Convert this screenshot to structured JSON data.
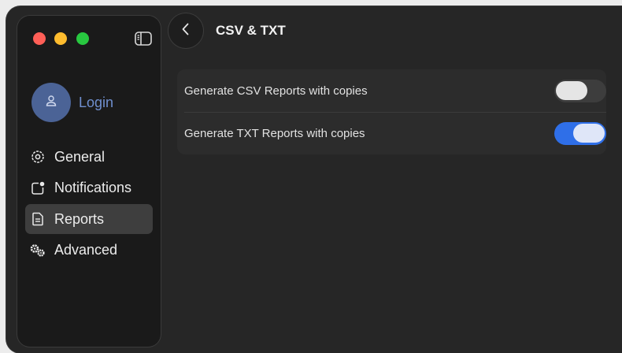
{
  "window": {
    "sidebar": {
      "profile": {
        "login_label": "Login",
        "avatar_icon": "person-icon"
      },
      "items": [
        {
          "label": "General",
          "icon": "gear-icon",
          "active": false
        },
        {
          "label": "Notifications",
          "icon": "notification-badge-icon",
          "active": false
        },
        {
          "label": "Reports",
          "icon": "document-icon",
          "active": true
        },
        {
          "label": "Advanced",
          "icon": "gears-icon",
          "active": false
        }
      ]
    },
    "header": {
      "title": "CSV & TXT",
      "back_icon": "chevron-left-icon"
    },
    "settings": [
      {
        "label": "Generate CSV Reports with copies",
        "enabled": false
      },
      {
        "label": "Generate TXT Reports with copies",
        "enabled": true
      }
    ]
  },
  "colors": {
    "accent": "#2f6fe8",
    "login_text": "#6f8fcf",
    "avatar_bg": "#4b6396",
    "traffic_red": "#ff5f57",
    "traffic_yellow": "#febc2e",
    "traffic_green": "#28c840"
  }
}
